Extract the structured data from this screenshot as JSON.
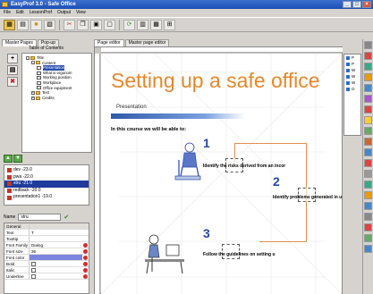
{
  "window": {
    "title": "EasyProf 3.0 - Safe Office"
  },
  "menu": [
    "File",
    "Edit",
    "LessonProf",
    "Output",
    "View"
  ],
  "left_tabs": [
    "Master Pages",
    "Pop-up"
  ],
  "toc": {
    "title": "Table of Contents",
    "items": [
      {
        "label": "Title",
        "level": 0,
        "expander": "-"
      },
      {
        "label": "Content",
        "level": 1,
        "expander": "-"
      },
      {
        "label": "Presentation",
        "level": 2,
        "selected": true
      },
      {
        "label": "What is ergonom",
        "level": 2
      },
      {
        "label": "Working position",
        "level": 2
      },
      {
        "label": "Workplace",
        "level": 2
      },
      {
        "label": "Office equipment",
        "level": 2
      },
      {
        "label": "Test",
        "level": 1,
        "expander": "+"
      },
      {
        "label": "Credits",
        "level": 1,
        "expander": "+"
      }
    ]
  },
  "objects": [
    {
      "label": "dev -23.0"
    },
    {
      "label": "pwa -22.0"
    },
    {
      "label": "stru -21.0",
      "selected": true
    },
    {
      "label": "redback -20.0"
    },
    {
      "label": "presentation1 -19.0"
    }
  ],
  "props": {
    "name_label": "Name",
    "name_value": "stru",
    "rows": [
      {
        "k": "General",
        "v": "",
        "cat": true
      },
      {
        "k": "Text",
        "v": "T"
      },
      {
        "k": "Tooltip",
        "v": ""
      },
      {
        "k": "Font Family",
        "v": "Dialog",
        "reset": true
      },
      {
        "k": "Font size",
        "v": "36",
        "reset": true
      },
      {
        "k": "Font color",
        "v": "",
        "reset": true,
        "highlight": true
      },
      {
        "k": "Bold",
        "v": "",
        "check": true,
        "reset": true
      },
      {
        "k": "Italic",
        "v": "",
        "check": true,
        "reset": true
      },
      {
        "k": "Underline",
        "v": "",
        "check": true,
        "reset": true
      }
    ]
  },
  "editor_tabs": [
    "Page editor",
    "Master page editor"
  ],
  "slide": {
    "title": "Setting up a safe office",
    "subtitle": "Presentation",
    "intro": "In this course we will be able to:",
    "steps": [
      {
        "num": "1",
        "text": "Identify the risks derived from an incor"
      },
      {
        "num": "2",
        "text": "Identify problems generated in u"
      },
      {
        "num": "3",
        "text": "Follow the guidelines on setting u"
      }
    ]
  },
  "right_list": [
    "P",
    "P",
    "W",
    "W",
    "W",
    "O"
  ],
  "colors": {
    "title_orange": "#e8872a",
    "step_blue": "#2747a8",
    "accent_bar": "#2f5aa8"
  }
}
